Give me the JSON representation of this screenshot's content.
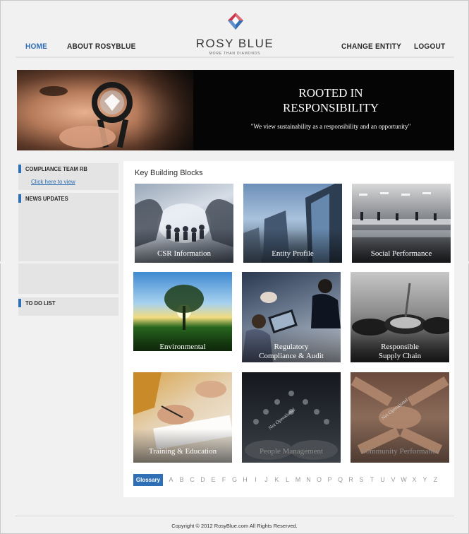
{
  "header": {
    "nav_left": [
      "HOME",
      "ABOUT ROSYBLUE"
    ],
    "nav_right": [
      "CHANGE ENTITY",
      "LOGOUT"
    ],
    "logo_name": "ROSY BLUE",
    "logo_tagline": "MORE THAN DIAMONDS"
  },
  "banner": {
    "title": "ROOTED IN\nRESPONSIBILITY",
    "quote": "\"We view sustainability as a responsibility and an opportunity\""
  },
  "sidebar": {
    "compliance_title": "COMPLIANCE TEAM RB",
    "compliance_link": "Click here to view",
    "news_title": "NEWS UPDATES",
    "todo_title": "TO DO LIST"
  },
  "main": {
    "title": "Key Building Blocks",
    "tiles": [
      {
        "label": "CSR Information",
        "active": true
      },
      {
        "label": "Entity Profile",
        "active": true
      },
      {
        "label": "Social Performance",
        "active": true
      },
      {
        "label": "Environmental\nPerformance",
        "active": true
      },
      {
        "label": "Regulatory\nCompliance & Audit",
        "active": true
      },
      {
        "label": "Responsible\nSupply Chain",
        "active": true
      },
      {
        "label": "Training & Education",
        "active": true
      },
      {
        "label": "People Management",
        "active": false,
        "stamp": "Not Operational"
      },
      {
        "label": "Community Performance",
        "active": false,
        "stamp": "Not Operational"
      }
    ]
  },
  "glossary": {
    "label": "Glossary",
    "letters": [
      "A",
      "B",
      "C",
      "D",
      "E",
      "F",
      "G",
      "H",
      "I",
      "J",
      "K",
      "L",
      "M",
      "N",
      "O",
      "P",
      "Q",
      "R",
      "S",
      "T",
      "U",
      "V",
      "W",
      "X",
      "Y",
      "Z"
    ]
  },
  "footer": {
    "copyright": "Copyright © 2012 RosyBlue.com All Rights Reserved."
  },
  "colors": {
    "accent": "#2f6fb6",
    "banner_bg": "#050505",
    "panel_bg": "#e4e4e4"
  }
}
